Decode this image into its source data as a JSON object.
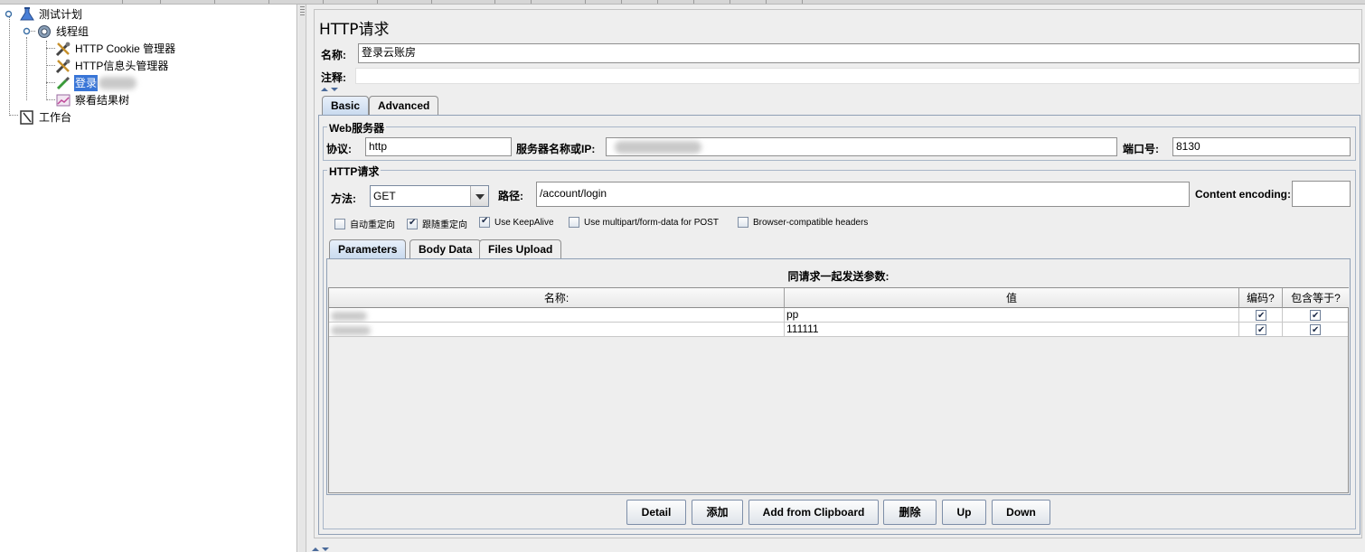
{
  "tree": {
    "test_plan": "测试计划",
    "thread_group": "线程组",
    "cookie_manager": "HTTP Cookie 管理器",
    "header_manager": "HTTP信息头管理器",
    "login_sampler": "登录",
    "result_tree": "察看结果树",
    "workbench": "工作台"
  },
  "panel": {
    "title": "HTTP请求",
    "name_label": "名称:",
    "name_value": "登录云账房",
    "comment_label": "注释:"
  },
  "tabs": {
    "basic": "Basic",
    "advanced": "Advanced"
  },
  "web_server": {
    "legend": "Web服务器",
    "protocol_label": "协议:",
    "protocol_value": "http",
    "server_label": "服务器名称或IP:",
    "port_label": "端口号:",
    "port_value": "8130"
  },
  "http_request": {
    "legend": "HTTP请求",
    "method_label": "方法:",
    "method_value": "GET",
    "path_label": "路径:",
    "path_value": "/account/login",
    "encoding_label": "Content encoding:"
  },
  "options": [
    {
      "label": "自动重定向",
      "checked": false
    },
    {
      "label": "跟随重定向",
      "checked": true
    },
    {
      "label": "Use KeepAlive",
      "checked": true
    },
    {
      "label": "Use multipart/form-data for POST",
      "checked": false
    },
    {
      "label": "Browser-compatible headers",
      "checked": false
    }
  ],
  "subtabs": {
    "parameters": "Parameters",
    "body_data": "Body Data",
    "files_upload": "Files Upload"
  },
  "params": {
    "caption": "同请求一起发送参数:",
    "columns": [
      "名称:",
      "值",
      "编码?",
      "包含等于?"
    ],
    "rows": [
      {
        "value": "pp",
        "encode": true,
        "include_equals": true
      },
      {
        "value": "111111",
        "encode": true,
        "include_equals": true
      }
    ]
  },
  "buttons": {
    "detail": "Detail",
    "add": "添加",
    "clipboard": "Add from Clipboard",
    "delete": "删除",
    "up": "Up",
    "down": "Down"
  }
}
